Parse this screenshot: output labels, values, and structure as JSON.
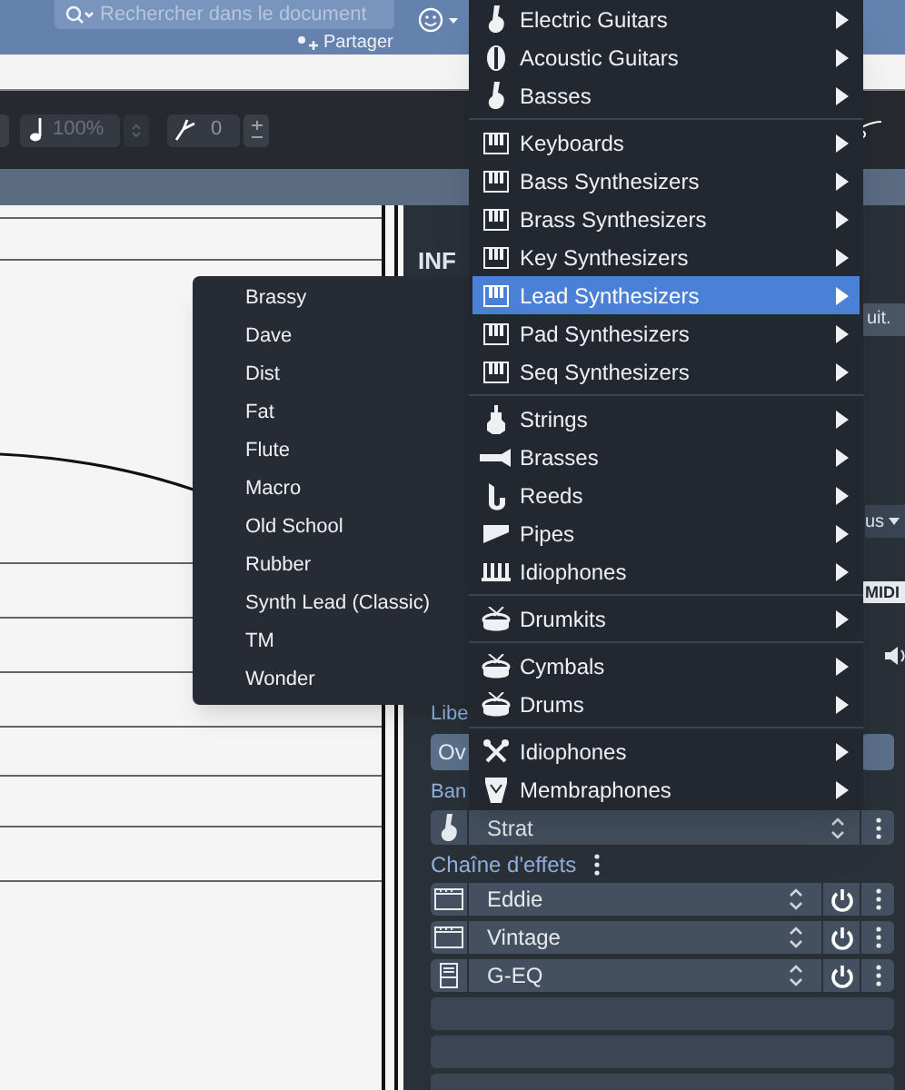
{
  "top_bar": {
    "search": {
      "placeholder": "Rechercher dans le document"
    },
    "share_button": "Partager"
  },
  "toolbar": {
    "tempo": {
      "value": "100%",
      "disabled": true
    },
    "transpose": {
      "value": "0",
      "disabled": false
    }
  },
  "inspector": {
    "heading": "INF",
    "button_1": "uit.",
    "dropdown_1": "us",
    "badge": "MIDI",
    "label_1": "Libe",
    "button_2": "Ov",
    "label_2": "Ban",
    "instrument": {
      "kind": "electric-guitar",
      "name": "Strat"
    },
    "effects_title": "Chaîne d'effets",
    "effects": [
      {
        "kind": "amp",
        "name": "Eddie"
      },
      {
        "kind": "amp",
        "name": "Vintage"
      },
      {
        "kind": "eq",
        "name": "G-EQ"
      }
    ]
  },
  "instrument_menu": {
    "groups": [
      {
        "items": [
          {
            "label": "Electric Guitars",
            "kind": "electric-guitar",
            "selected": false
          },
          {
            "label": "Acoustic Guitars",
            "kind": "acoustic-guitar",
            "selected": false
          },
          {
            "label": "Basses",
            "kind": "electric-guitar",
            "selected": false
          }
        ]
      },
      {
        "items": [
          {
            "label": "Keyboards",
            "kind": "keyboard",
            "selected": false
          },
          {
            "label": "Bass Synthesizers",
            "kind": "keyboard",
            "selected": false
          },
          {
            "label": "Brass Synthesizers",
            "kind": "keyboard",
            "selected": false
          },
          {
            "label": "Key Synthesizers",
            "kind": "keyboard",
            "selected": false
          },
          {
            "label": "Lead Synthesizers",
            "kind": "keyboard",
            "selected": true
          },
          {
            "label": "Pad Synthesizers",
            "kind": "keyboard",
            "selected": false
          },
          {
            "label": "Seq Synthesizers",
            "kind": "keyboard",
            "selected": false
          }
        ]
      },
      {
        "items": [
          {
            "label": "Strings",
            "kind": "strings",
            "selected": false
          },
          {
            "label": "Brasses",
            "kind": "trumpet",
            "selected": false
          },
          {
            "label": "Reeds",
            "kind": "saxophone",
            "selected": false
          },
          {
            "label": "Pipes",
            "kind": "pipe",
            "selected": false
          },
          {
            "label": "Idiophones",
            "kind": "mallet",
            "selected": false
          }
        ]
      },
      {
        "items": [
          {
            "label": "Drumkits",
            "kind": "drum",
            "selected": false
          }
        ]
      },
      {
        "items": [
          {
            "label": "Cymbals",
            "kind": "drum",
            "selected": false
          },
          {
            "label": "Drums",
            "kind": "drum",
            "selected": false
          }
        ]
      },
      {
        "items": [
          {
            "label": "Idiophones",
            "kind": "sticks",
            "selected": false
          },
          {
            "label": "Membraphones",
            "kind": "hand-drum",
            "selected": false
          }
        ]
      }
    ]
  },
  "preset_menu": {
    "items": [
      "Brassy",
      "Dave",
      "Dist",
      "Fat",
      "Flute",
      "Macro",
      "Old School",
      "Rubber",
      "Synth Lead (Classic)",
      "TM",
      "Wonder"
    ]
  }
}
